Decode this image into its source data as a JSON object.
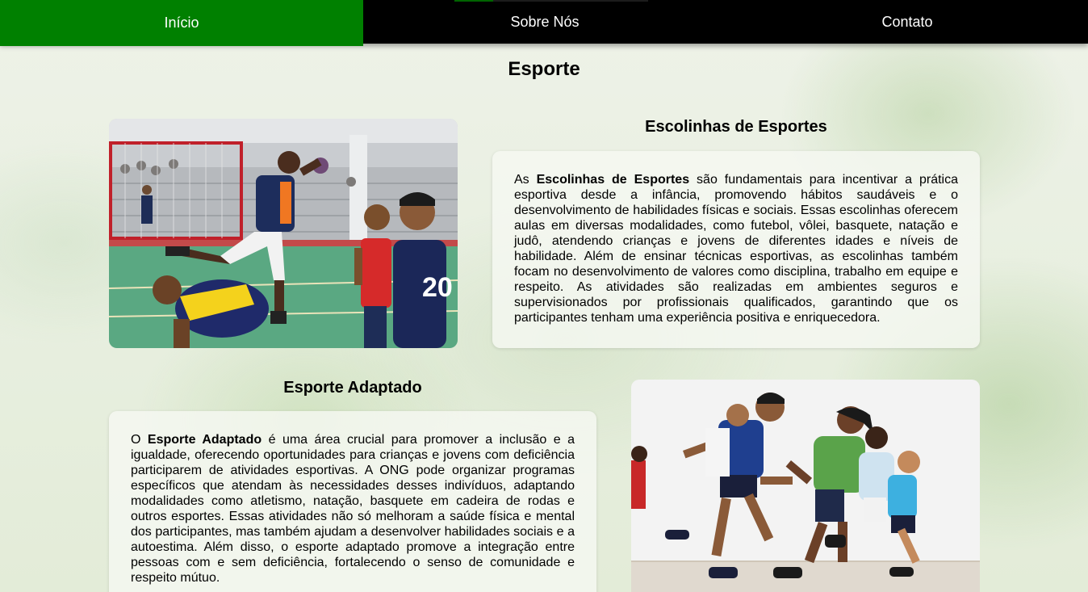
{
  "nav": {
    "items": [
      {
        "label": "Início",
        "active": true
      },
      {
        "label": "Sobre Nós",
        "active": false
      },
      {
        "label": "Contato",
        "active": false
      }
    ]
  },
  "page": {
    "title": "Esporte"
  },
  "sections": [
    {
      "heading": "Escolinhas de Esportes",
      "bold_term": "Escolinhas de Esportes",
      "text_before": "As ",
      "text_after": " são fundamentais para incentivar a prática esportiva desde a infância, promovendo hábitos saudáveis e o desenvolvimento de habilidades físicas e sociais. Essas escolinhas oferecem aulas em diversas modalidades, como futebol, vôlei, basquete, natação e judô, atendendo crianças e jovens de diferentes idades e níveis de habilidade. Além de ensinar técnicas esportivas, as escolinhas também focam no desenvolvimento de valores como disciplina, trabalho em equipe e respeito. As atividades são realizadas em ambientes seguros e supervisionados por profissionais qualificados, garantindo que os participantes tenham uma experiência positiva e enriquecedora.",
      "image_icon": "handball-photo"
    },
    {
      "heading": "Esporte Adaptado",
      "bold_term": "Esporte Adaptado",
      "text_before": "O ",
      "text_after": " é uma área crucial para promover a inclusão e a igualdade, oferecendo oportunidades para crianças e jovens com deficiência participarem de atividades esportivas. A ONG pode organizar programas específicos que atendam às necessidades desses indivíduos, adaptando modalidades como atletismo, natação, basquete em cadeira de rodas e outros esportes. Essas atividades não só melhoram a saúde física e mental dos participantes, mas também ajudam a desenvolver habilidades sociais e a autoestima. Além disso, o esporte adaptado promove a integração entre pessoas com e sem deficiência, fortalecendo o senso de comunidade e respeito mútuo.",
      "image_icon": "running-kids-photo"
    }
  ],
  "colors": {
    "nav_bg": "#000000",
    "nav_active": "#008000",
    "nav_text": "#ffffff"
  },
  "jersey_number": "20"
}
